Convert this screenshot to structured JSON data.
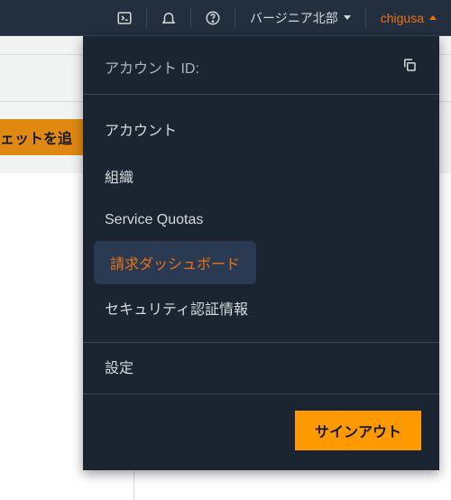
{
  "topbar": {
    "region_label": "バージニア北部",
    "user_label": "chigusa"
  },
  "page": {
    "widget_button_label": "ジェットを追"
  },
  "dropdown": {
    "account_id_label": "アカウント ID:",
    "menu": {
      "account": "アカウント",
      "organization": "組織",
      "service_quotas": "Service Quotas",
      "billing_dashboard": "請求ダッシュボード",
      "security_credentials": "セキュリティ認証情報"
    },
    "settings_label": "設定",
    "signout_label": "サインアウト"
  }
}
